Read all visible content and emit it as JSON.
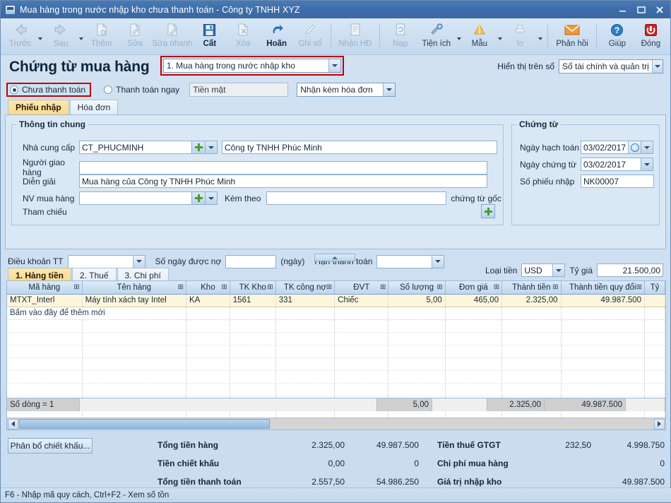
{
  "window": {
    "title": "Mua hàng trong nước nhập kho chưa thanh toán - Công ty TNHH XYZ",
    "minimize": "–",
    "maximize": "▭",
    "close": "✕"
  },
  "toolbar": [
    {
      "label": "Trước",
      "icon": "back-arrow-icon",
      "disabled": true,
      "dropdown": true
    },
    {
      "label": "Sau",
      "icon": "forward-arrow-icon",
      "disabled": true,
      "dropdown": true
    },
    {
      "label": "Thêm",
      "icon": "add-document-icon",
      "disabled": true,
      "dropdown": false
    },
    {
      "label": "Sửa",
      "icon": "edit-document-icon",
      "disabled": true,
      "dropdown": false
    },
    {
      "label": "Sửa nhanh",
      "icon": "quick-edit-icon",
      "disabled": true,
      "dropdown": false
    },
    {
      "label": "Cất",
      "icon": "save-floppy-icon",
      "disabled": false,
      "dropdown": false
    },
    {
      "label": "Xóa",
      "icon": "delete-document-icon",
      "disabled": true,
      "dropdown": false
    },
    {
      "label": "Hoãn",
      "icon": "undo-arrow-icon",
      "disabled": false,
      "dropdown": false
    },
    {
      "label": "Ghi sổ",
      "icon": "pencil-icon",
      "disabled": true,
      "dropdown": false
    },
    {
      "label": "Nhận HĐ",
      "icon": "invoice-icon",
      "disabled": true,
      "dropdown": false
    },
    {
      "label": "Nạp",
      "icon": "reload-icon",
      "disabled": true,
      "dropdown": false
    },
    {
      "label": "Tiện ích",
      "icon": "tools-icon",
      "disabled": false,
      "dropdown": true
    },
    {
      "label": "Mẫu",
      "icon": "ruler-icon",
      "disabled": false,
      "dropdown": true
    },
    {
      "label": "In",
      "icon": "printer-icon",
      "disabled": true,
      "dropdown": true
    },
    {
      "label": "Phản hồi",
      "icon": "envelope-icon",
      "disabled": false,
      "dropdown": false
    },
    {
      "label": "Giúp",
      "icon": "help-circle-icon",
      "disabled": false,
      "dropdown": false
    },
    {
      "label": "Đóng",
      "icon": "close-power-icon",
      "disabled": false,
      "dropdown": false
    }
  ],
  "header": {
    "page_title": "Chứng từ mua hàng",
    "doc_type_value": "1. Mua hàng trong nước nhập kho",
    "display_on_label": "Hiển thị trên sổ",
    "display_on_value": "Sổ tài chính và quản trị"
  },
  "payment": {
    "unpaid_label": "Chưa thanh toán",
    "unpaid_selected": true,
    "paynow_label": "Thanh toán ngay",
    "paynow_selected": false,
    "cash_value": "Tiền mặt",
    "invoice_mode_value": "Nhận kèm hóa đơn"
  },
  "tabs": [
    {
      "label": "Phiếu nhập",
      "active": true
    },
    {
      "label": "Hóa đơn",
      "active": false
    }
  ],
  "general_info": {
    "legend": "Thông tin chung",
    "supplier_label": "Nhà cung cấp",
    "supplier_code": "CT_PHUCMINH",
    "supplier_name": "Công ty TNHH Phúc Minh",
    "deliverer_label": "Người giao hàng",
    "deliverer_value": "",
    "description_label": "Diễn giải",
    "description_value": "Mua hàng của Công ty TNHH Phúc Minh",
    "buyer_label": "NV mua hàng",
    "buyer_value": "",
    "attach_label": "Kèm theo",
    "attach_value": "",
    "attach_suffix": "chứng từ gốc",
    "reference_label": "Tham chiếu"
  },
  "document": {
    "legend": "Chứng từ",
    "posting_date_label": "Ngày hạch toán",
    "posting_date_value": "03/02/2017",
    "doc_date_label": "Ngày chứng từ",
    "doc_date_value": "03/02/2017",
    "receipt_no_label": "Số phiếu nhập",
    "receipt_no_value": "NK00007"
  },
  "terms": {
    "term_label": "Điều khoản TT",
    "term_value": "",
    "credit_days_label": "Số ngày được nợ",
    "credit_days_value": "",
    "days_unit": "(ngày)",
    "due_date_label": "Hạn thanh toán",
    "due_date_value": ""
  },
  "sub_tabs": [
    {
      "label": "1. Hàng tiền",
      "active": true
    },
    {
      "label": "2. Thuế",
      "active": false
    },
    {
      "label": "3. Chi phí",
      "active": false
    }
  ],
  "currency": {
    "label": "Loại tiền",
    "value": "USD",
    "rate_label": "Tỷ giá",
    "rate_value": "21.500,00"
  },
  "grid": {
    "columns": [
      "Mã hàng",
      "Tên hàng",
      "Kho",
      "TK Kho",
      "TK công nợ",
      "ĐVT",
      "Số lượng",
      "Đơn giá",
      "Thành tiền",
      "Thành tiền quy đổi",
      "Tỷ"
    ],
    "rows": [
      {
        "ma_hang": "MTXT_Interl",
        "ten_hang": "Máy tính xách tay Intel",
        "kho": "KA",
        "tk_kho": "1561",
        "tk_cong_no": "331",
        "dvt": "Chiếc",
        "so_luong": "5,00",
        "don_gia": "465,00",
        "thanh_tien": "2.325,00",
        "thanh_tien_quy_doi": "49.987.500",
        "ty": ""
      }
    ],
    "add_row_text": "Bấm vào đây để thêm mới",
    "footer": {
      "row_count_label": "Số dòng = 1",
      "so_luong": "5,00",
      "thanh_tien": "2.325,00",
      "thanh_tien_quy_doi": "49.987.500"
    }
  },
  "totals": {
    "discount_button": "Phân bổ chiết khấu...",
    "left": [
      {
        "label": "Tổng tiền hàng",
        "amount": "2.325,00",
        "converted": "49.987.500"
      },
      {
        "label": "Tiền chiết khấu",
        "amount": "0,00",
        "converted": "0"
      },
      {
        "label": "Tổng tiền thanh toán",
        "amount": "2.557,50",
        "converted": "54.986.250"
      }
    ],
    "right": [
      {
        "label": "Tiền thuế GTGT",
        "amount": "232,50",
        "converted": "4.998.750"
      },
      {
        "label": "Chi phí mua hàng",
        "amount": "",
        "converted": "0"
      },
      {
        "label": "Giá trị nhập kho",
        "amount": "",
        "converted": "49.987.500"
      }
    ]
  },
  "status_bar": {
    "text": "F6 - Nhập mã quy cách, Ctrl+F2 - Xem số tồn"
  },
  "colors": {
    "title_bar": "#3e6ea9",
    "accent_red": "#c00000",
    "active_tab": "#fbd98a",
    "row_highlight": "#fdf6dd",
    "panel_bg": "#dae8f6"
  }
}
